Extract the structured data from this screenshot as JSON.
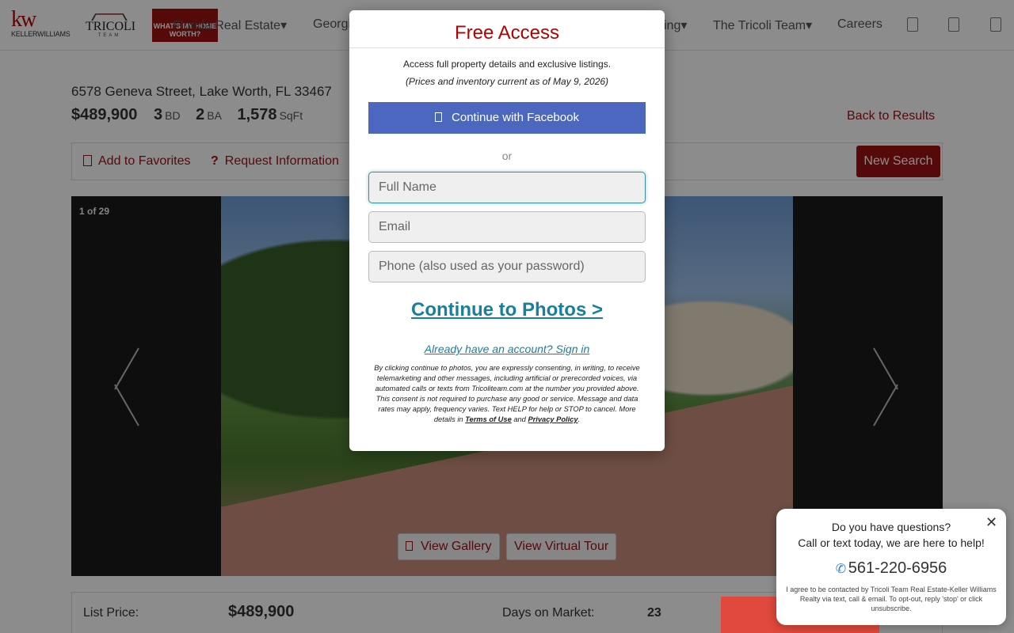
{
  "header": {
    "kw_logo": "kw",
    "kw_sub": "KELLERWILLIAMS",
    "tricoli_logo": "TRICOLI",
    "tricoli_team": "TEAM",
    "worth_logo": "WHAT'S MY HOME WORTH?",
    "nav": [
      "Florida Real Estate▾",
      "Georgia",
      "ing▾",
      "The Tricoli Team▾",
      "Careers"
    ],
    "icons": [
      "user-icon",
      "heart-icon",
      "phone-icon"
    ]
  },
  "property": {
    "address": "6578 Geneva Street, Lake Worth, FL 33467",
    "price": "$489,900",
    "beds": "3",
    "beds_unit": "BD",
    "baths": "2",
    "baths_unit": "BA",
    "sqft": "1,578",
    "sqft_unit": "SqFt",
    "back_link": "Back to Results"
  },
  "toolbar": {
    "favorites": "Add to Favorites",
    "request": "Request Information",
    "new_search": "New Search"
  },
  "gallery": {
    "counter": "1 of 29",
    "view_gallery": "View Gallery",
    "virtual_tour": "View Virtual Tour"
  },
  "details": {
    "list_price_label": "List Price:",
    "list_price_value": "$489,900",
    "dom_label": "Days on Market:",
    "dom_value": "23"
  },
  "modal": {
    "title": "Free Access",
    "subtitle": "Access full property details and exclusive listings.",
    "prices_note": "(Prices and inventory current as of May 9, 2026)",
    "facebook": "Continue with Facebook",
    "or": "or",
    "name_placeholder": "Full Name",
    "email_placeholder": "Email",
    "phone_placeholder": "Phone (also used as your password)",
    "cta": "Continue to Photos >",
    "signin": "Already have an account? Sign in",
    "legal_text": "By clicking continue to photos, you are expressly consenting, in writing, to receive telemarketing and other messages, including artificial or prerecorded voices, via automated calls or texts from Tricoliteam.com at the number you provided above. This consent is not required to purchase any good or service. Message and data rates may apply, frequency varies. Text HELP for help or STOP to cancel. More details in",
    "terms": "Terms of Use",
    "and": "and",
    "privacy": "Privacy Policy",
    "period": "."
  },
  "chat": {
    "question": "Do you have questions?",
    "prompt": "Call or text today, we are here to help!",
    "phone": "561-220-6956",
    "consent": "I agree to be contacted by Tricoli Team Real Estate-Keller Williams Realty via text, call & email. To opt-out, reply 'stop' or click unsubscribe.",
    "close": "✕"
  }
}
